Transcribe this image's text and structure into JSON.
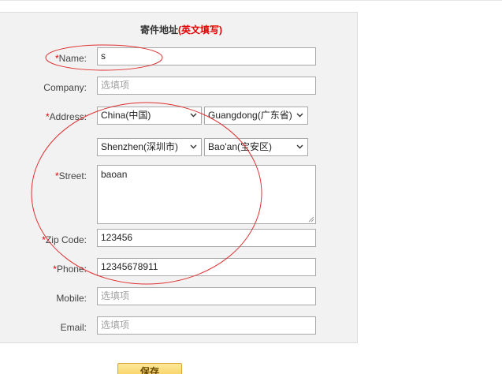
{
  "form": {
    "title": "寄件地址",
    "title_hint": "(英文填写)"
  },
  "fields": {
    "name": {
      "req": "*",
      "label": "Name:",
      "value": "s"
    },
    "company": {
      "label": "Company:",
      "placeholder": "选填项"
    },
    "address": {
      "req": "*",
      "label": "Address:",
      "country": "China(中国)",
      "province": "Guangdong(广东省)",
      "city": "Shenzhen(深圳市)",
      "district": "Bao'an(宝安区)"
    },
    "street": {
      "req": "*",
      "label": "Street:",
      "value": "baoan"
    },
    "zip": {
      "req": "*",
      "label": "Zip Code:",
      "value": "123456"
    },
    "phone": {
      "req": "*",
      "label": "Phone:",
      "value": "12345678911"
    },
    "mobile": {
      "label": "Mobile:",
      "placeholder": "选填项"
    },
    "email": {
      "label": "Email:",
      "placeholder": "选填项"
    }
  },
  "actions": {
    "save_label": "保存"
  },
  "colors": {
    "required": "#e60000",
    "annotation": "#e03030",
    "panel_bg": "#f2f2f2",
    "save_bg": "#f7c94e"
  },
  "icons": {
    "select_arrow": "chevron-down-icon",
    "resize_grip": "resize-grip-icon"
  }
}
